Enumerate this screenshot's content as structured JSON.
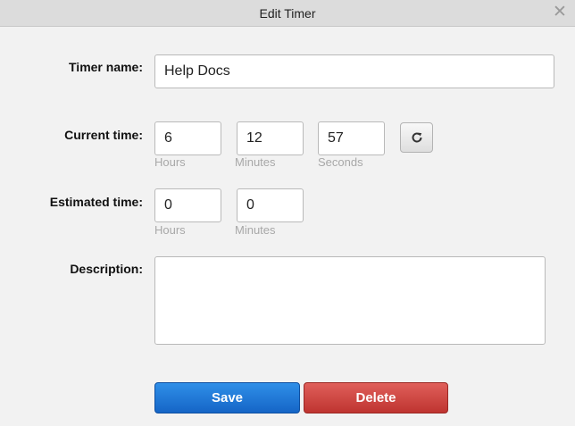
{
  "dialog": {
    "title": "Edit Timer",
    "close_icon": "close-icon"
  },
  "form": {
    "timer_name": {
      "label": "Timer name:",
      "value": "Help Docs"
    },
    "current_time": {
      "label": "Current time:",
      "hours": {
        "value": "6",
        "caption": "Hours"
      },
      "minutes": {
        "value": "12",
        "caption": "Minutes"
      },
      "seconds": {
        "value": "57",
        "caption": "Seconds"
      },
      "reset_icon": "refresh-icon"
    },
    "estimated_time": {
      "label": "Estimated time:",
      "hours": {
        "value": "0",
        "caption": "Hours"
      },
      "minutes": {
        "value": "0",
        "caption": "Minutes"
      }
    },
    "description": {
      "label": "Description:",
      "value": ""
    }
  },
  "actions": {
    "save_label": "Save",
    "delete_label": "Delete"
  },
  "colors": {
    "save": "#1e75d6",
    "delete": "#cf4742",
    "title_bar": "#dcdcdc"
  }
}
